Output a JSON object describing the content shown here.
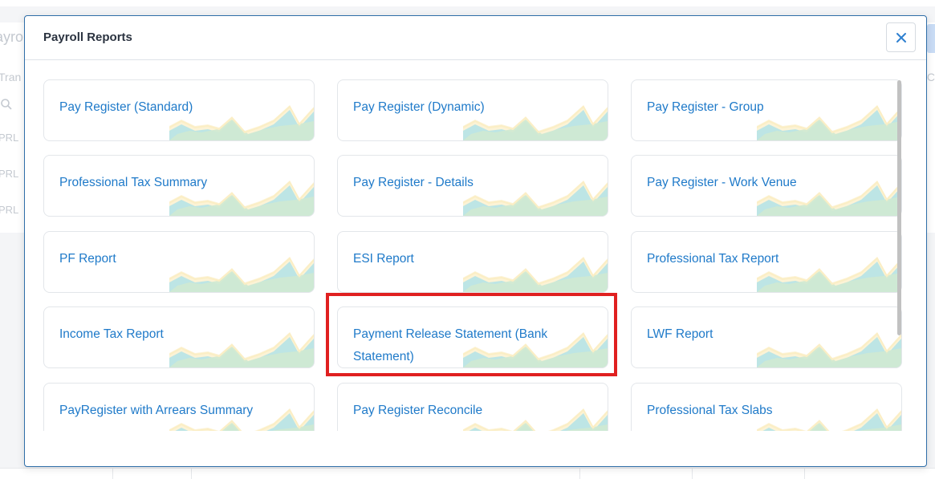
{
  "modal": {
    "title": "Payroll Reports",
    "close_icon": "close-icon"
  },
  "reports": [
    {
      "label": "Pay Register (Standard)"
    },
    {
      "label": "Pay Register (Dynamic)"
    },
    {
      "label": "Pay Register - Group"
    },
    {
      "label": "Professional Tax Summary"
    },
    {
      "label": "Pay Register - Details"
    },
    {
      "label": "Pay Register - Work Venue"
    },
    {
      "label": "PF Report"
    },
    {
      "label": "ESI Report"
    },
    {
      "label": "Professional Tax Report"
    },
    {
      "label": "Income Tax Report"
    },
    {
      "label": "Payment Release Statement (Bank Statement)"
    },
    {
      "label": "LWF Report"
    },
    {
      "label": "PayRegister with Arrears Summary"
    },
    {
      "label": "Pay Register Reconcile"
    },
    {
      "label": "Professional Tax Slabs"
    }
  ],
  "background": {
    "title_fragment": "ayro",
    "tab_fragment": "Tran",
    "row_fragment": "PRL",
    "right_fragment": "C"
  },
  "colors": {
    "link": "#1f7ac9",
    "modal_border": "#2f6ea8",
    "highlight": "#e02020",
    "spark_blue": "#a8e0ea",
    "spark_green": "#cfe9d2",
    "spark_yellow": "#fbeec5"
  },
  "highlighted_report": "Payment Release Statement (Bank Statement)"
}
